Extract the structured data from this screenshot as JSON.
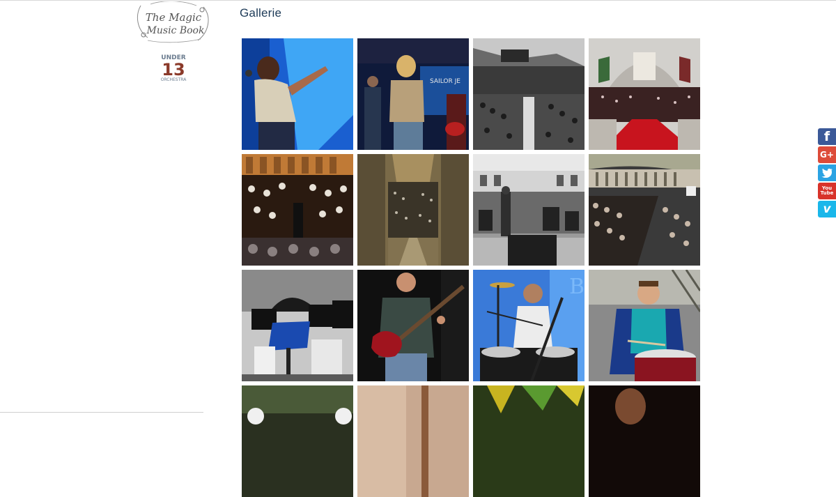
{
  "header": {
    "title": "Gallerie"
  },
  "logos": {
    "magic_music_book": {
      "line1": "The Magic",
      "line2": "Music Book"
    },
    "under13": {
      "top": "UNDER",
      "number": "13",
      "sub": "ORCHESTRA"
    }
  },
  "gallery": {
    "tiles": [
      {
        "label": "singer-blue-stage"
      },
      {
        "label": "band-sailor-jerry"
      },
      {
        "label": "orchestra-hall-bw"
      },
      {
        "label": "church-concert-red-carpet"
      },
      {
        "label": "orchestra-conductor-stage"
      },
      {
        "label": "basilica-orchestra-aerial"
      },
      {
        "label": "rehearsal-bw"
      },
      {
        "label": "auditorium-audience"
      },
      {
        "label": "music-stands-bw"
      },
      {
        "label": "guitarist-red-guitar"
      },
      {
        "label": "drummer-blue-kit"
      },
      {
        "label": "boy-drummer"
      },
      {
        "label": "partial-row-1"
      },
      {
        "label": "partial-row-2"
      },
      {
        "label": "partial-row-3"
      },
      {
        "label": "partial-row-4"
      }
    ]
  },
  "social": {
    "facebook": "f",
    "googleplus": "G+",
    "twitter": "t",
    "youtube_top": "You",
    "youtube_bottom": "Tube",
    "vimeo": "v"
  },
  "colors": {
    "title": "#1d3a57",
    "facebook": "#3b5998",
    "googleplus": "#dd4b39",
    "twitter": "#2ba3e3",
    "youtube": "#d8332a",
    "vimeo": "#1ab7ea"
  }
}
